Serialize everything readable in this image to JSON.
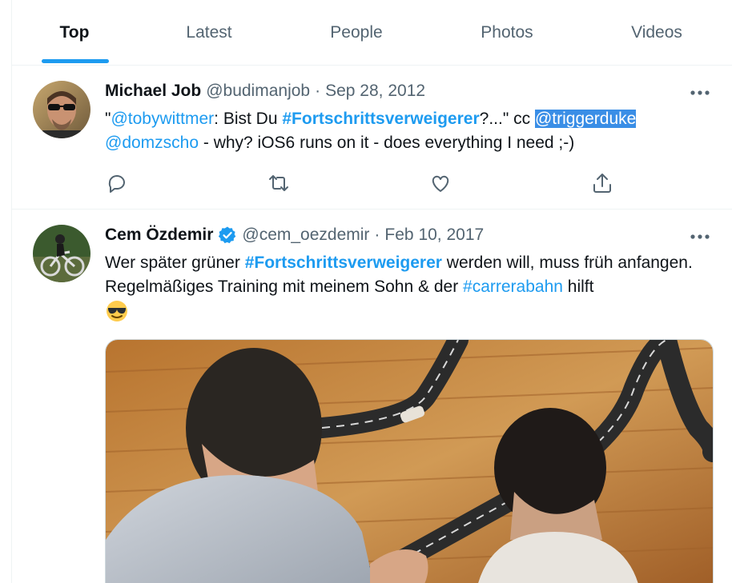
{
  "tabs": [
    {
      "label": "Top",
      "active": true
    },
    {
      "label": "Latest",
      "active": false
    },
    {
      "label": "People",
      "active": false
    },
    {
      "label": "Photos",
      "active": false
    },
    {
      "label": "Videos",
      "active": false
    }
  ],
  "tweets": [
    {
      "name": "Michael Job",
      "handle": "@budimanjob",
      "separator": "·",
      "date": "Sep 28, 2012",
      "text_parts": {
        "p1": "\"",
        "mention1": "@tobywittmer",
        "p2": ": Bist Du ",
        "hashtag1": "#Fortschrittsverweigerer",
        "p3": "?...\" cc ",
        "mention2": "@triggerduke",
        "p4": " ",
        "mention3": "@domzscho",
        "p5": "  -  why? iOS6 runs on it - does everything I need ;-)"
      }
    },
    {
      "name": "Cem Özdemir",
      "handle": "@cem_oezdemir",
      "separator": "·",
      "date": "Feb 10, 2017",
      "text_parts": {
        "p1": "Wer später grüner ",
        "hashtag1": "#Fortschrittsverweigerer",
        "p2": " werden will, muss früh anfangen. Regelmäßiges Training mit meinem Sohn & der ",
        "hashtag2": "#carrerabahn",
        "p3": " hilft "
      }
    }
  ],
  "icons": {
    "more": "more-horizontal-icon",
    "reply": "reply-icon",
    "retweet": "retweet-icon",
    "like": "heart-icon",
    "share": "share-icon",
    "verified": "verified-badge-icon",
    "emoji": "sunglasses-emoji"
  },
  "colors": {
    "accent": "#1d9bf0",
    "text": "#0f1419",
    "muted": "#536471",
    "selection": "#3a8ee6"
  }
}
